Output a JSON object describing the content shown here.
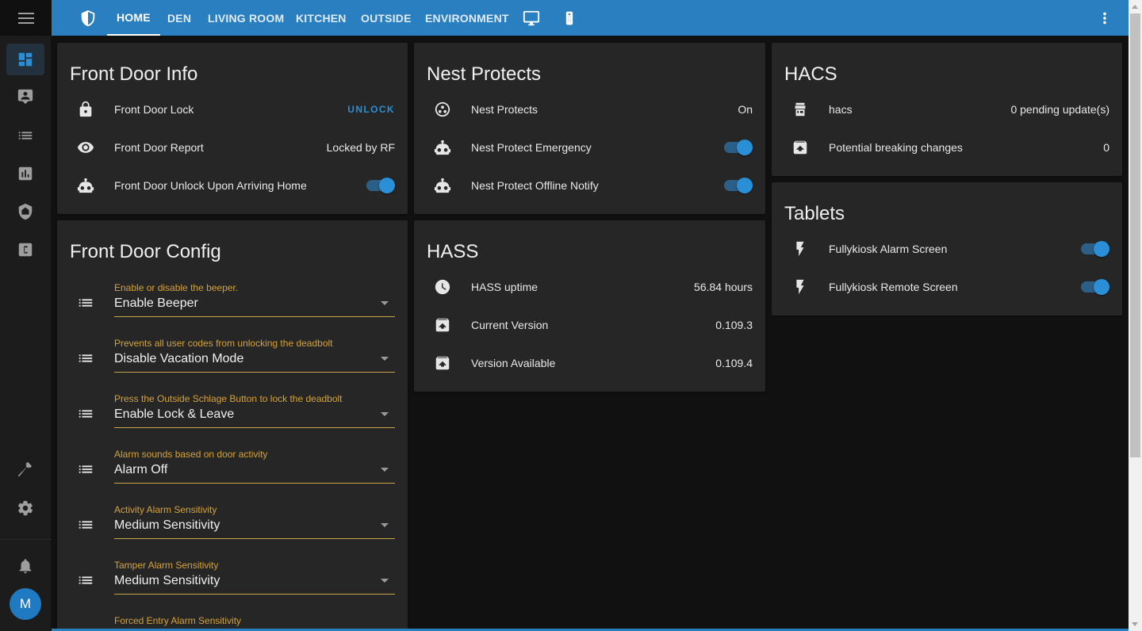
{
  "header": {
    "tabs": [
      {
        "label": "HOME",
        "active": true
      },
      {
        "label": "DEN"
      },
      {
        "label": "LIVING ROOM"
      },
      {
        "label": "KITCHEN"
      },
      {
        "label": "OUTSIDE"
      },
      {
        "label": "ENVIRONMENT"
      }
    ],
    "icons": [
      "shield-icon",
      "monitor-icon",
      "remote-icon",
      "more-vert-icon"
    ],
    "accent_color": "#2a7fc0"
  },
  "sidebar": {
    "items": [
      "overview-icon",
      "map-icon",
      "logbook-icon",
      "history-icon",
      "hacs-shield-icon",
      "custom-c-icon",
      "developer-tools-icon",
      "settings-icon",
      "notifications-icon"
    ],
    "user_initial": "M"
  },
  "front_door_info": {
    "title": "Front Door Info",
    "rows": [
      {
        "name": "Front Door Lock",
        "action": "UNLOCK",
        "icon": "lock-icon"
      },
      {
        "name": "Front Door Report",
        "state": "Locked by RF",
        "icon": "eye-icon"
      },
      {
        "name": "Front Door Unlock Upon Arriving Home",
        "toggle": true,
        "icon": "robot-icon"
      }
    ]
  },
  "front_door_config": {
    "title": "Front Door Config",
    "selects": [
      {
        "label": "Enable or disable the beeper.",
        "value": "Enable Beeper"
      },
      {
        "label": "Prevents all user codes from unlocking the deadbolt",
        "value": "Disable Vacation Mode"
      },
      {
        "label": "Press the Outside Schlage Button to lock the deadbolt",
        "value": "Enable Lock & Leave"
      },
      {
        "label": "Alarm sounds based on door activity",
        "value": "Alarm Off"
      },
      {
        "label": "Activity Alarm Sensitivity",
        "value": "Medium Sensitivity"
      },
      {
        "label": "Tamper Alarm Sensitivity",
        "value": "Medium Sensitivity"
      },
      {
        "label": "Forced Entry Alarm Sensitivity",
        "value": ""
      }
    ]
  },
  "nest_protects": {
    "title": "Nest Protects",
    "rows": [
      {
        "name": "Nest Protects",
        "state": "On",
        "icon": "google-circles-icon"
      },
      {
        "name": "Nest Protect Emergency",
        "toggle": true,
        "icon": "robot-icon"
      },
      {
        "name": "Nest Protect Offline Notify",
        "toggle": true,
        "icon": "robot-icon"
      }
    ]
  },
  "hass": {
    "title": "HASS",
    "rows": [
      {
        "name": "HASS uptime",
        "state": "56.84 hours",
        "icon": "clock-icon"
      },
      {
        "name": "Current Version",
        "state": "0.109.3",
        "icon": "package-up-icon"
      },
      {
        "name": "Version Available",
        "state": "0.109.4",
        "icon": "package-up-icon"
      }
    ]
  },
  "hacs": {
    "title": "HACS",
    "rows": [
      {
        "name": "hacs",
        "state": "0 pending update(s)",
        "icon": "hacs-icon"
      },
      {
        "name": "Potential breaking changes",
        "state": "0",
        "icon": "package-up-icon"
      }
    ]
  },
  "tablets": {
    "title": "Tablets",
    "rows": [
      {
        "name": "Fullykiosk Alarm Screen",
        "toggle": true,
        "icon": "flash-icon"
      },
      {
        "name": "Fullykiosk Remote Screen",
        "toggle": true,
        "icon": "flash-icon"
      }
    ]
  }
}
